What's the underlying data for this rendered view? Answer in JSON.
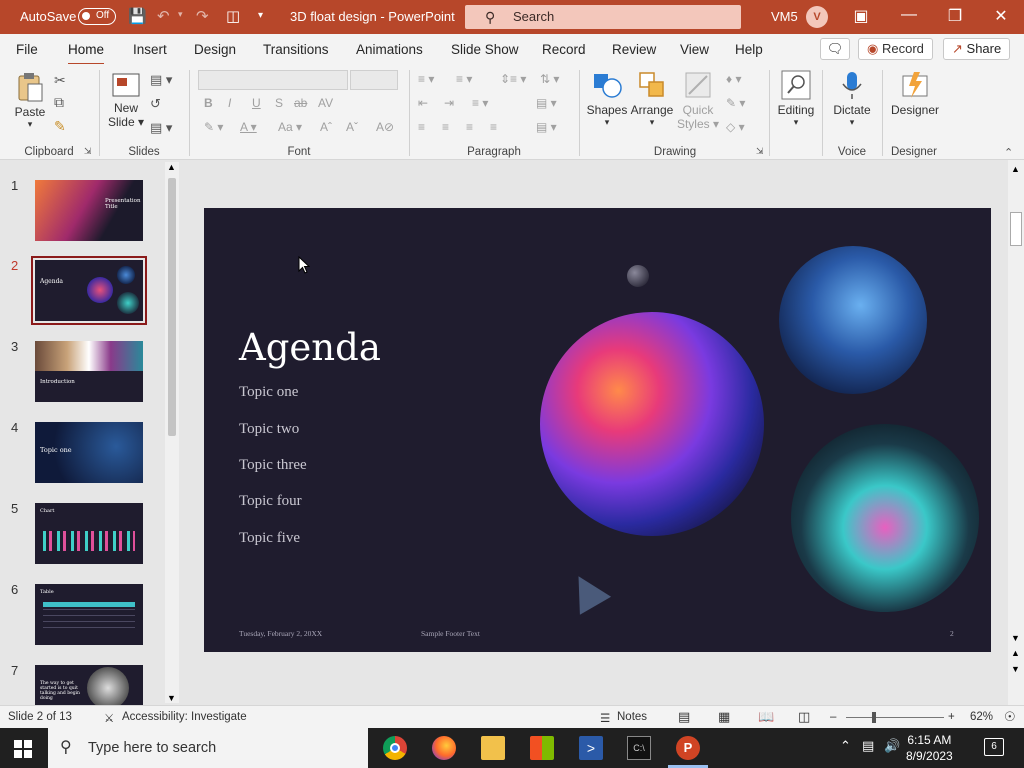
{
  "titlebar": {
    "autosave_label": "AutoSave",
    "autosave_state": "Off",
    "doc_title": "3D float design",
    "app_name": "PowerPoint",
    "separator": " - ",
    "search_placeholder": "Search",
    "user_name": "VM5",
    "avatar_initial": "V",
    "accent": "#b7472a"
  },
  "tabs": {
    "items": [
      "File",
      "Home",
      "Insert",
      "Design",
      "Transitions",
      "Animations",
      "Slide Show",
      "Record",
      "Review",
      "View",
      "Help"
    ],
    "active": "Home",
    "record_button": "Record",
    "share_button": "Share"
  },
  "ribbon": {
    "clipboard": {
      "label": "Clipboard",
      "paste": "Paste"
    },
    "slides": {
      "label": "Slides",
      "new_slide_line1": "New",
      "new_slide_line2": "Slide"
    },
    "font": {
      "label": "Font"
    },
    "paragraph": {
      "label": "Paragraph"
    },
    "drawing": {
      "label": "Drawing",
      "shapes": "Shapes",
      "arrange": "Arrange",
      "quick_styles_line1": "Quick",
      "quick_styles_line2": "Styles"
    },
    "editing": {
      "label": "Editing"
    },
    "voice": {
      "label": "Voice",
      "dictate": "Dictate"
    },
    "designer": {
      "label": "Designer",
      "designer_button": "Designer"
    }
  },
  "thumbnails": {
    "numbers": [
      "1",
      "2",
      "3",
      "4",
      "5",
      "6",
      "7"
    ],
    "selected": "2",
    "t1_title": "Presentation Title",
    "t2_title": "Agenda",
    "t3_title": "Introduction",
    "t4_title": "Topic one",
    "t5_title": "Chart",
    "t6_title": "Table",
    "t7_text": "The way to get started is to quit talking and begin doing"
  },
  "slide": {
    "title": "Agenda",
    "topics": [
      "Topic one",
      "Topic two",
      "Topic three",
      "Topic four",
      "Topic five"
    ],
    "footer_date": "Tuesday, February 2, 20XX",
    "footer_text": "Sample Footer Text",
    "page_number": "2"
  },
  "status": {
    "slide_info": "Slide 2 of 13",
    "accessibility": "Accessibility: Investigate",
    "notes": "Notes",
    "zoom": "62%"
  },
  "taskbar": {
    "search_placeholder": "Type here to search",
    "time": "6:15 AM",
    "date": "8/9/2023",
    "notification_count": "6"
  }
}
